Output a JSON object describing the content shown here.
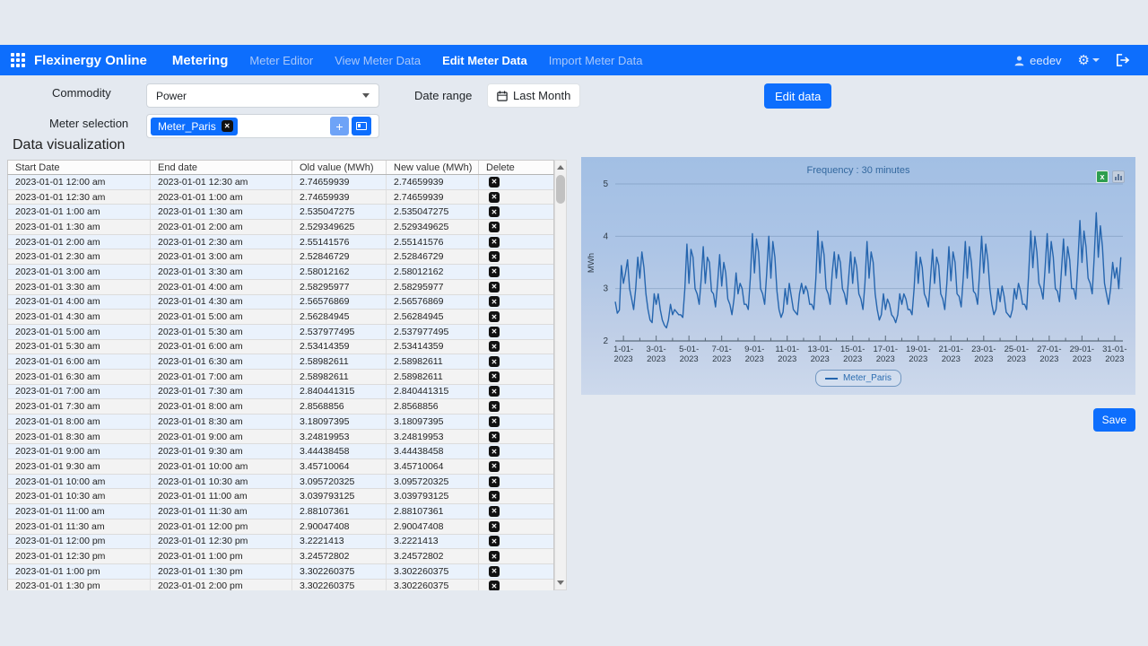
{
  "navbar": {
    "brand": "Flexinergy Online",
    "section": "Metering",
    "items": [
      {
        "label": "Meter Editor",
        "active": false
      },
      {
        "label": "View Meter Data",
        "active": false
      },
      {
        "label": "Edit Meter Data",
        "active": true
      },
      {
        "label": "Import Meter Data",
        "active": false
      }
    ],
    "user": "eedev"
  },
  "filters": {
    "commodity_label": "Commodity",
    "commodity_value": "Power",
    "daterange_label": "Date range",
    "daterange_value": "Last Month",
    "meter_label": "Meter selection",
    "meter_tag": "Meter_Paris",
    "edit_data_label": "Edit data",
    "save_label": "Save"
  },
  "section_title": "Data visualization",
  "icons": {
    "close": "✕",
    "plus": "+",
    "gear": "⚙",
    "excel": "x"
  },
  "table": {
    "columns": [
      "Start Date",
      "End date",
      "Old value (MWh)",
      "New value (MWh)",
      "Delete"
    ],
    "rows": [
      [
        "2023-01-01 12:00 am",
        "2023-01-01 12:30 am",
        "2.74659939",
        "2.74659939"
      ],
      [
        "2023-01-01 12:30 am",
        "2023-01-01 1:00 am",
        "2.74659939",
        "2.74659939"
      ],
      [
        "2023-01-01 1:00 am",
        "2023-01-01 1:30 am",
        "2.535047275",
        "2.535047275"
      ],
      [
        "2023-01-01 1:30 am",
        "2023-01-01 2:00 am",
        "2.529349625",
        "2.529349625"
      ],
      [
        "2023-01-01 2:00 am",
        "2023-01-01 2:30 am",
        "2.55141576",
        "2.55141576"
      ],
      [
        "2023-01-01 2:30 am",
        "2023-01-01 3:00 am",
        "2.52846729",
        "2.52846729"
      ],
      [
        "2023-01-01 3:00 am",
        "2023-01-01 3:30 am",
        "2.58012162",
        "2.58012162"
      ],
      [
        "2023-01-01 3:30 am",
        "2023-01-01 4:00 am",
        "2.58295977",
        "2.58295977"
      ],
      [
        "2023-01-01 4:00 am",
        "2023-01-01 4:30 am",
        "2.56576869",
        "2.56576869"
      ],
      [
        "2023-01-01 4:30 am",
        "2023-01-01 5:00 am",
        "2.56284945",
        "2.56284945"
      ],
      [
        "2023-01-01 5:00 am",
        "2023-01-01 5:30 am",
        "2.537977495",
        "2.537977495"
      ],
      [
        "2023-01-01 5:30 am",
        "2023-01-01 6:00 am",
        "2.53414359",
        "2.53414359"
      ],
      [
        "2023-01-01 6:00 am",
        "2023-01-01 6:30 am",
        "2.58982611",
        "2.58982611"
      ],
      [
        "2023-01-01 6:30 am",
        "2023-01-01 7:00 am",
        "2.58982611",
        "2.58982611"
      ],
      [
        "2023-01-01 7:00 am",
        "2023-01-01 7:30 am",
        "2.840441315",
        "2.840441315"
      ],
      [
        "2023-01-01 7:30 am",
        "2023-01-01 8:00 am",
        "2.8568856",
        "2.8568856"
      ],
      [
        "2023-01-01 8:00 am",
        "2023-01-01 8:30 am",
        "3.18097395",
        "3.18097395"
      ],
      [
        "2023-01-01 8:30 am",
        "2023-01-01 9:00 am",
        "3.24819953",
        "3.24819953"
      ],
      [
        "2023-01-01 9:00 am",
        "2023-01-01 9:30 am",
        "3.44438458",
        "3.44438458"
      ],
      [
        "2023-01-01 9:30 am",
        "2023-01-01 10:00 am",
        "3.45710064",
        "3.45710064"
      ],
      [
        "2023-01-01 10:00 am",
        "2023-01-01 10:30 am",
        "3.095720325",
        "3.095720325"
      ],
      [
        "2023-01-01 10:30 am",
        "2023-01-01 11:00 am",
        "3.039793125",
        "3.039793125"
      ],
      [
        "2023-01-01 11:00 am",
        "2023-01-01 11:30 am",
        "2.88107361",
        "2.88107361"
      ],
      [
        "2023-01-01 11:30 am",
        "2023-01-01 12:00 pm",
        "2.90047408",
        "2.90047408"
      ],
      [
        "2023-01-01 12:00 pm",
        "2023-01-01 12:30 pm",
        "3.2221413",
        "3.2221413"
      ],
      [
        "2023-01-01 12:30 pm",
        "2023-01-01 1:00 pm",
        "3.24572802",
        "3.24572802"
      ],
      [
        "2023-01-01 1:00 pm",
        "2023-01-01 1:30 pm",
        "3.302260375",
        "3.302260375"
      ],
      [
        "2023-01-01 1:30 pm",
        "2023-01-01 2:00 pm",
        "3.302260375",
        "3.302260375"
      ]
    ]
  },
  "chart_data": {
    "type": "line",
    "title": "Frequency : 30 minutes",
    "ylabel": "MWh",
    "ylim": [
      2,
      5
    ],
    "yticks": [
      2,
      3,
      4,
      5
    ],
    "xtick_labels": [
      "1-01-2023",
      "3-01-2023",
      "5-01-2023",
      "7-01-2023",
      "9-01-2023",
      "11-01-2023",
      "13-01-2023",
      "15-01-2023",
      "17-01-2023",
      "19-01-2023",
      "21-01-2023",
      "23-01-2023",
      "25-01-2023",
      "27-01-2023",
      "29-01-2023",
      "31-01-2023"
    ],
    "legend_position": "bottom",
    "grid": true,
    "x_start": "2023-01-01 00:00",
    "x_step_hours": 3,
    "series": [
      {
        "name": "Meter_Paris",
        "values": [
          2.75,
          2.53,
          2.59,
          3.44,
          3.1,
          3.3,
          3.55,
          3.0,
          2.8,
          2.6,
          3.0,
          3.6,
          3.2,
          3.7,
          3.4,
          2.9,
          2.6,
          2.4,
          2.35,
          2.9,
          2.7,
          2.9,
          2.6,
          2.4,
          2.3,
          2.25,
          2.4,
          2.7,
          2.5,
          2.6,
          2.55,
          2.5,
          2.5,
          2.45,
          3.0,
          3.85,
          3.1,
          3.75,
          3.6,
          3.0,
          2.9,
          2.7,
          3.2,
          3.8,
          3.1,
          3.6,
          3.5,
          2.95,
          2.9,
          2.65,
          3.1,
          3.65,
          3.05,
          3.5,
          3.3,
          2.8,
          2.7,
          2.5,
          2.8,
          3.3,
          2.9,
          3.1,
          3.0,
          2.7,
          2.7,
          2.6,
          3.2,
          4.05,
          3.3,
          3.95,
          3.7,
          3.0,
          2.9,
          2.7,
          3.3,
          4.0,
          3.2,
          3.9,
          3.6,
          2.95,
          2.6,
          2.45,
          2.55,
          3.0,
          2.7,
          3.1,
          2.85,
          2.6,
          2.55,
          2.5,
          2.9,
          3.1,
          2.9,
          3.05,
          2.95,
          2.7,
          2.7,
          2.6,
          3.2,
          4.1,
          3.3,
          3.9,
          3.65,
          3.0,
          2.9,
          2.7,
          3.3,
          3.7,
          3.2,
          3.65,
          3.5,
          3.0,
          2.9,
          2.7,
          3.2,
          3.7,
          3.1,
          3.6,
          3.4,
          2.9,
          2.8,
          2.6,
          3.1,
          3.9,
          3.2,
          3.7,
          3.5,
          2.9,
          2.6,
          2.4,
          2.5,
          2.9,
          2.6,
          2.8,
          2.7,
          2.5,
          2.45,
          2.35,
          2.5,
          2.9,
          2.7,
          2.9,
          2.8,
          2.6,
          2.6,
          2.5,
          3.0,
          3.7,
          3.1,
          3.6,
          3.4,
          2.9,
          2.8,
          2.65,
          3.2,
          3.75,
          3.1,
          3.6,
          3.45,
          2.9,
          2.8,
          2.6,
          3.1,
          3.8,
          3.15,
          3.7,
          3.5,
          2.9,
          2.85,
          2.65,
          3.2,
          3.9,
          3.2,
          3.8,
          3.5,
          2.95,
          2.9,
          2.7,
          3.3,
          4.0,
          3.3,
          3.85,
          3.55,
          3.0,
          2.7,
          2.5,
          2.6,
          3.0,
          2.75,
          3.05,
          2.85,
          2.55,
          2.5,
          2.45,
          2.6,
          3.0,
          2.8,
          3.1,
          2.95,
          2.7,
          2.7,
          2.6,
          3.3,
          4.1,
          3.4,
          4.0,
          3.7,
          3.1,
          3.0,
          2.8,
          3.4,
          4.05,
          3.3,
          3.9,
          3.6,
          3.0,
          2.95,
          2.75,
          3.35,
          3.95,
          3.25,
          3.8,
          3.55,
          3.0,
          3.0,
          2.8,
          3.5,
          4.3,
          3.5,
          4.1,
          3.8,
          3.2,
          3.1,
          2.9,
          3.6,
          4.45,
          3.6,
          4.2,
          3.8,
          3.1,
          2.9,
          2.7,
          3.0,
          3.5,
          3.2,
          3.4,
          3.0,
          3.6
        ]
      }
    ]
  }
}
